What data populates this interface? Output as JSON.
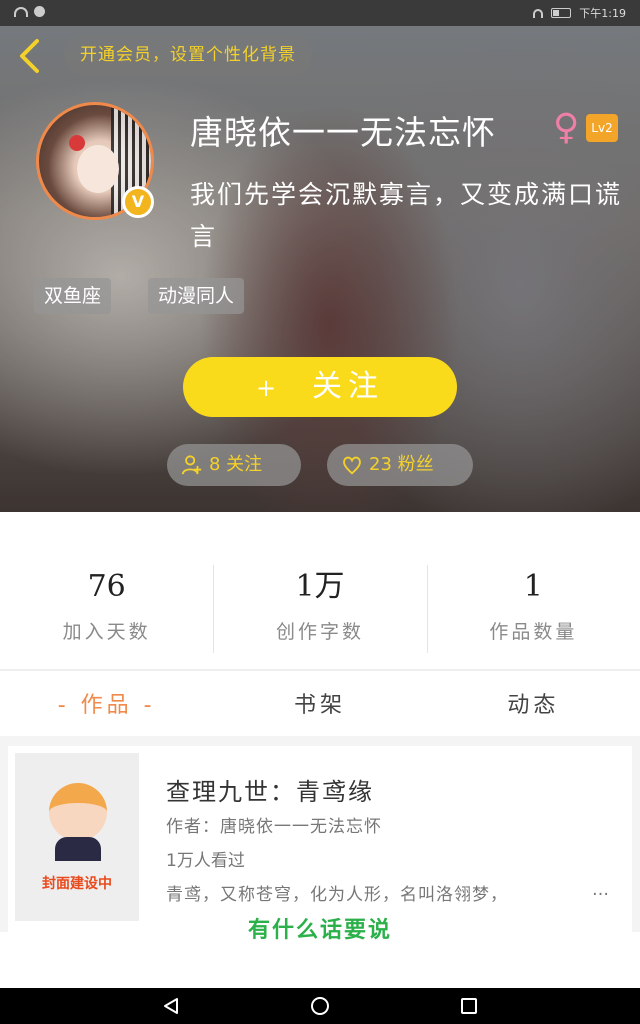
{
  "status": {
    "time": "下午1:19"
  },
  "header": {
    "vip_promo": "开通会员，设置个性化背景",
    "username": "唐晓依一一无法忘怀",
    "gender_symbol": "♀",
    "level": "Lv2",
    "verified_badge": "V",
    "bio": "我们先学会沉默寡言，又变成满口谎言",
    "tags": [
      "双鱼座",
      "动漫同人"
    ],
    "follow_plus": "+",
    "follow_label": "关注",
    "following": "8 关注",
    "fans": "23 粉丝"
  },
  "stats": [
    {
      "value": "76",
      "label": "加入天数"
    },
    {
      "value": "1万",
      "label": "创作字数"
    },
    {
      "value": "1",
      "label": "作品数量"
    }
  ],
  "tabs": [
    "作品",
    "书架",
    "动态"
  ],
  "work": {
    "cover_text": "封面建设中",
    "title": "查理九世：青鸢缘",
    "author": "作者：唐晓依一一无法忘怀",
    "views": "1万人看过",
    "description": "青鸢，又称苍穹，化为人形，名叫洛翎梦，",
    "ellipsis": "…"
  },
  "chat_prompt": "有什么话要说",
  "colors": {
    "accent_yellow": "#fadb1c",
    "accent_orange": "#f08a4b",
    "chat_green": "#2bb04a"
  }
}
